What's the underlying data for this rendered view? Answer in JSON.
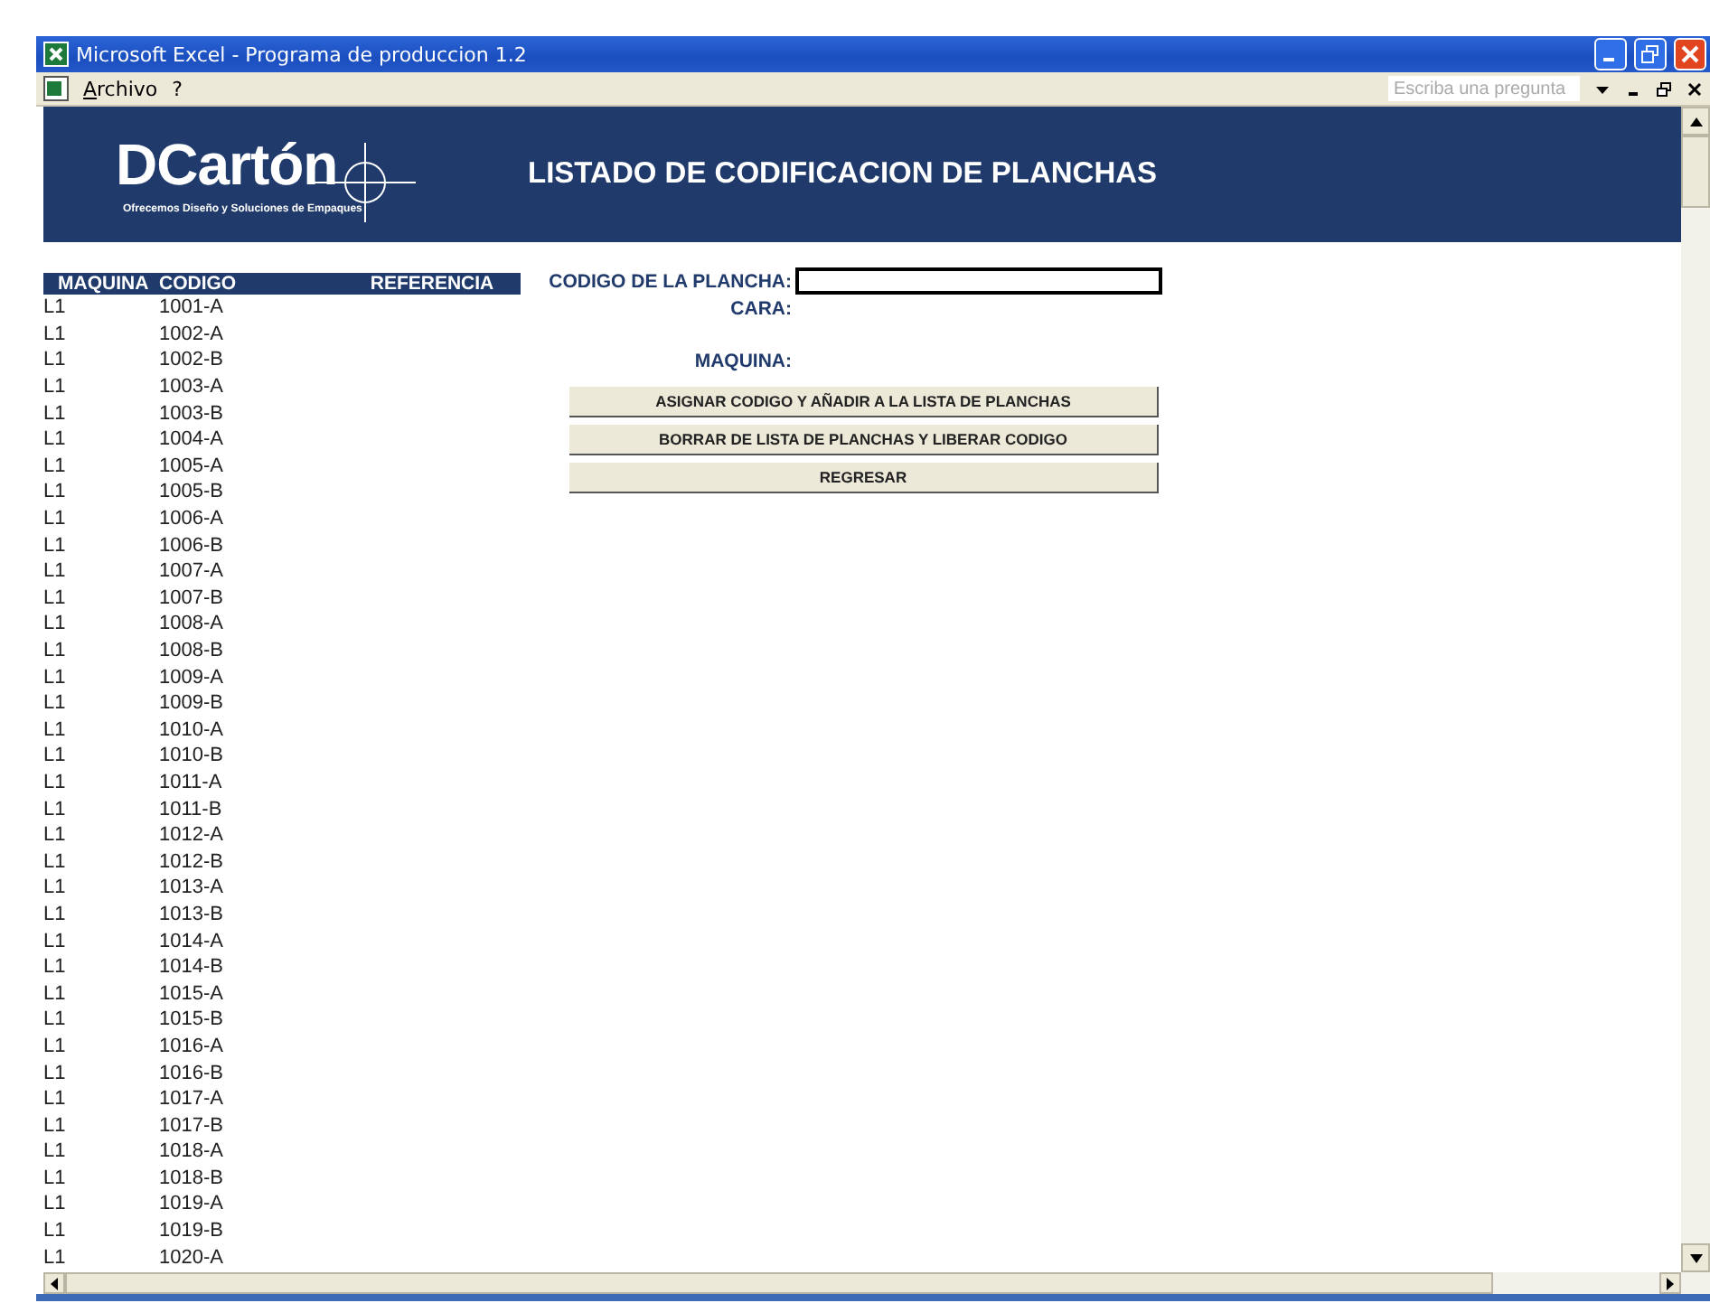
{
  "window": {
    "title": "Microsoft Excel - Programa de produccion 1.2"
  },
  "menu": {
    "items": [
      "Archivo",
      "?"
    ],
    "help_search": {
      "placeholder": "Escriba una pregunta"
    }
  },
  "banner": {
    "logo": "DCartón",
    "tagline": "Ofrecemos Diseño y Soluciones de Empaques",
    "title": "LISTADO DE CODIFICACION DE PLANCHAS"
  },
  "table": {
    "columns": [
      "MAQUINA",
      "CODIGO",
      "REFERENCIA"
    ],
    "rows": [
      [
        "L1",
        "1001-A"
      ],
      [
        "L1",
        "1002-A"
      ],
      [
        "L1",
        "1002-B"
      ],
      [
        "L1",
        "1003-A"
      ],
      [
        "L1",
        "1003-B"
      ],
      [
        "L1",
        "1004-A"
      ],
      [
        "L1",
        "1005-A"
      ],
      [
        "L1",
        "1005-B"
      ],
      [
        "L1",
        "1006-A"
      ],
      [
        "L1",
        "1006-B"
      ],
      [
        "L1",
        "1007-A"
      ],
      [
        "L1",
        "1007-B"
      ],
      [
        "L1",
        "1008-A"
      ],
      [
        "L1",
        "1008-B"
      ],
      [
        "L1",
        "1009-A"
      ],
      [
        "L1",
        "1009-B"
      ],
      [
        "L1",
        "1010-A"
      ],
      [
        "L1",
        "1010-B"
      ],
      [
        "L1",
        "1011-A"
      ],
      [
        "L1",
        "1011-B"
      ],
      [
        "L1",
        "1012-A"
      ],
      [
        "L1",
        "1012-B"
      ],
      [
        "L1",
        "1013-A"
      ],
      [
        "L1",
        "1013-B"
      ],
      [
        "L1",
        "1014-A"
      ],
      [
        "L1",
        "1014-B"
      ],
      [
        "L1",
        "1015-A"
      ],
      [
        "L1",
        "1015-B"
      ],
      [
        "L1",
        "1016-A"
      ],
      [
        "L1",
        "1016-B"
      ],
      [
        "L1",
        "1017-A"
      ],
      [
        "L1",
        "1017-B"
      ],
      [
        "L1",
        "1018-A"
      ],
      [
        "L1",
        "1018-B"
      ],
      [
        "L1",
        "1019-A"
      ],
      [
        "L1",
        "1019-B"
      ],
      [
        "L1",
        "1020-A"
      ]
    ]
  },
  "form": {
    "fields": [
      {
        "label": "CODIGO DE LA PLANCHA:",
        "kind": "input"
      },
      {
        "label": "CARA:",
        "kind": "text"
      },
      {
        "label": "MAQUINA:",
        "kind": "text"
      }
    ],
    "buttons": [
      "ASIGNAR CODIGO Y AÑADIR A LA LISTA DE PLANCHAS",
      "BORRAR DE LISTA DE PLANCHAS Y LIBERAR CODIGO",
      "REGRESAR"
    ]
  }
}
